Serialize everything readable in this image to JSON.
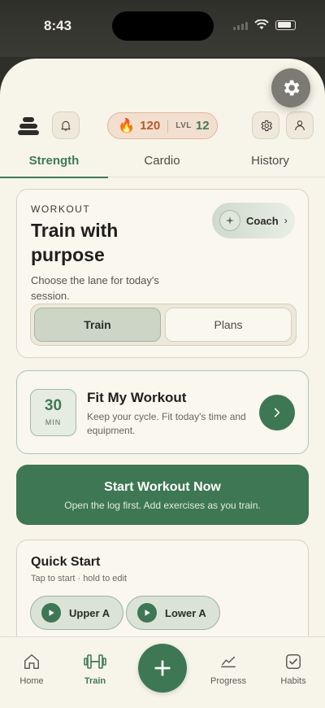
{
  "status_bar": {
    "time": "8:43"
  },
  "header": {
    "streak_count": "120",
    "level_label": "LVL",
    "level_value": "12"
  },
  "tabs": [
    {
      "label": "Strength",
      "active": true
    },
    {
      "label": "Cardio",
      "active": false
    },
    {
      "label": "History",
      "active": false
    }
  ],
  "workout_card": {
    "eyebrow": "WORKOUT",
    "title": "Train with purpose",
    "subtitle": "Choose the lane for today's session.",
    "coach_label": "Coach",
    "segments": [
      {
        "label": "Train",
        "selected": true
      },
      {
        "label": "Plans",
        "selected": false
      }
    ]
  },
  "fit_card": {
    "minutes": "30",
    "minutes_unit": "MIN",
    "title": "Fit My Workout",
    "subtitle": "Keep your cycle. Fit today's time and equipment."
  },
  "start_button": {
    "title": "Start Workout Now",
    "subtitle": "Open the log first. Add exercises as you train."
  },
  "quick_start": {
    "title": "Quick Start",
    "subtitle": "Tap to start · hold to edit",
    "items": [
      {
        "label": "Upper A"
      },
      {
        "label": "Lower A"
      }
    ]
  },
  "bottom_nav": {
    "items": [
      {
        "label": "Home",
        "icon": "home-icon"
      },
      {
        "label": "Train",
        "icon": "dumbbell-icon",
        "active": true
      },
      {
        "label": "Progress",
        "icon": "chart-icon"
      },
      {
        "label": "Habits",
        "icon": "checkbox-icon"
      }
    ]
  },
  "colors": {
    "accent": "#3e7753",
    "streak": "#b55a2a",
    "background": "#f7f4ea"
  }
}
